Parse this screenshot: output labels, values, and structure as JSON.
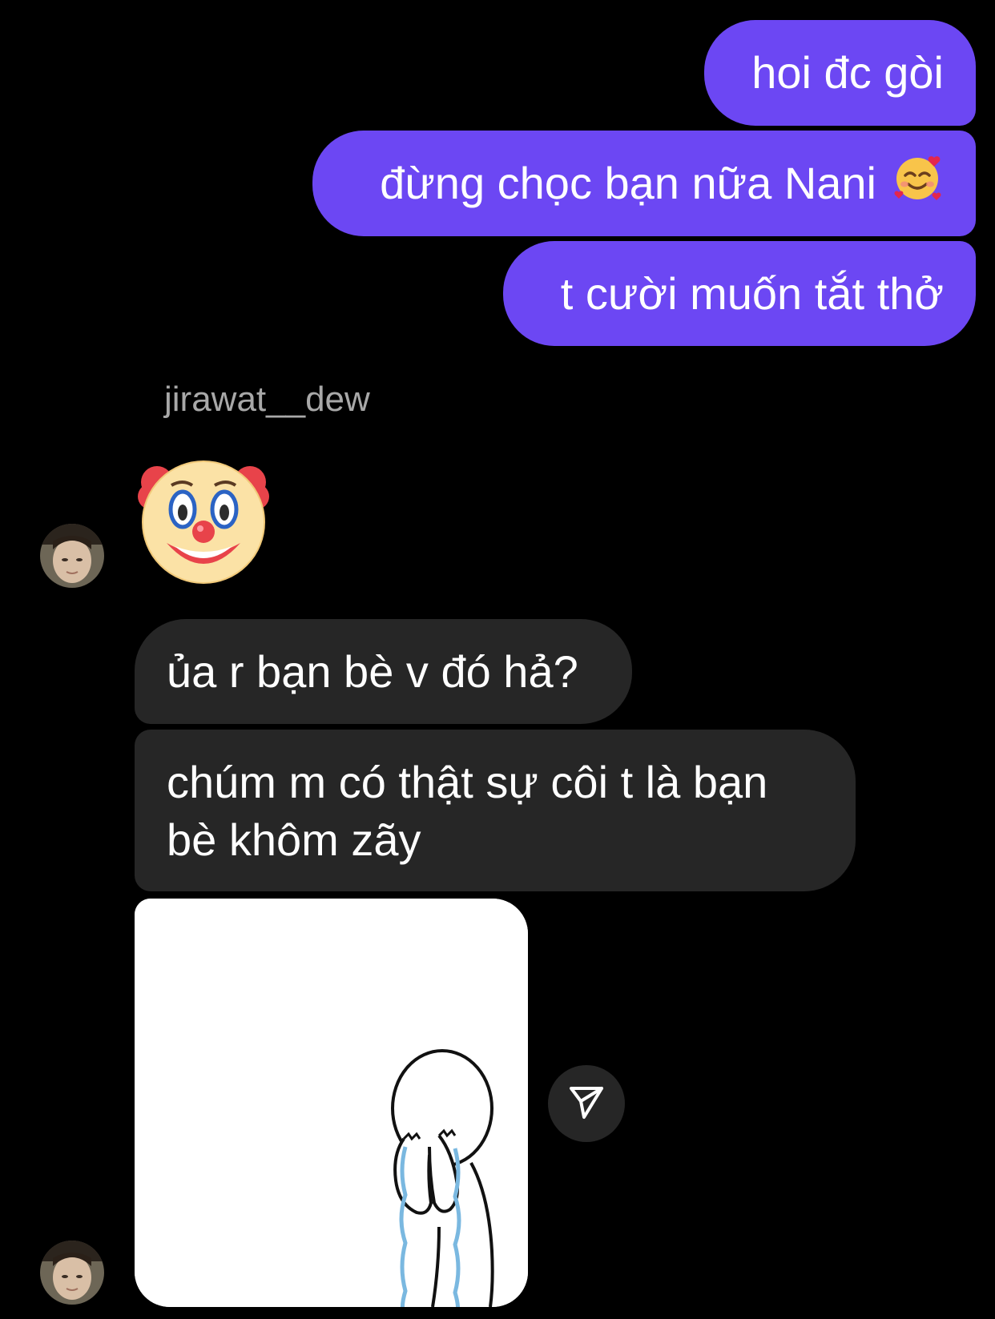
{
  "messages_outgoing": [
    {
      "text": "hoi đc gòi"
    },
    {
      "text": "đừng chọc bạn nữa Nani",
      "emoji": "smiling-face-with-hearts-icon"
    },
    {
      "text": "t cười muốn tắt thở"
    }
  ],
  "sender": {
    "username": "jirawat__dew"
  },
  "messages_incoming": [
    {
      "emoji": "clown-face-icon"
    },
    {
      "text": "ủa r bạn bè v đó hả?"
    },
    {
      "text": "chúm m có thật sự côi t là bạn bè khôm zãy"
    }
  ],
  "colors": {
    "background": "#000000",
    "outgoing_bubble": "#6c47f3",
    "incoming_bubble": "#262626",
    "username": "#a8a8a8"
  },
  "icons": {
    "share": "paper-plane-icon",
    "avatar": "user-avatar"
  }
}
